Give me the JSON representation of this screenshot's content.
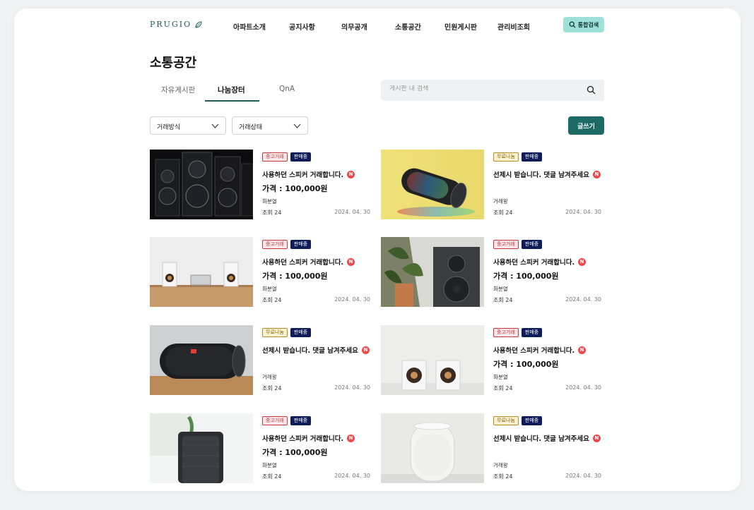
{
  "header": {
    "logo": "PRUGIO",
    "nav": [
      "아파트소개",
      "공지사항",
      "의무공개",
      "소통공간",
      "민원게시판",
      "관리비조회"
    ],
    "search_button": "통합검색"
  },
  "page_title": "소통공간",
  "tabs": [
    "자유게시판",
    "나눔장터",
    "QnA"
  ],
  "active_tab": "나눔장터",
  "board_search": {
    "placeholder": "게시판 내 검색"
  },
  "filters": {
    "method": "거래방식",
    "status": "거래상태"
  },
  "write_button": "글쓰기",
  "colors": {
    "accent": "#1e6a66",
    "used_badge": "#c5393d",
    "free_badge": "#b88c25",
    "sale_badge": "#0f1c5a",
    "new_dot": "#f0474b"
  },
  "posts": [
    {
      "image": "speaker-wall-photo",
      "type": "중고거래",
      "state": "판매중",
      "title": "사용하던 스피커 거래합니다.",
      "new": "N",
      "price": "가격 : 100,000원",
      "author": "화분열",
      "views": "조회 24",
      "date": "2024. 04. 30"
    },
    {
      "image": "cylinder-speaker-yellow-photo",
      "type": "무료나눔",
      "state": "판매중",
      "title": "선제시 받습니다. 댓글 남겨주세요",
      "new": "N",
      "price": "",
      "author": "거래왕",
      "views": "조회 24",
      "date": "2024. 04. 30"
    },
    {
      "image": "bookshelf-speakers-photo",
      "type": "중고거래",
      "state": "판매중",
      "title": "사용하던 스피커 거래합니다.",
      "new": "N",
      "price": "가격 : 100,000원",
      "author": "화분열",
      "views": "조회 24",
      "date": "2024. 04. 30"
    },
    {
      "image": "speaker-plant-photo",
      "type": "중고거래",
      "state": "판매중",
      "title": "사용하던 스피커 거래합니다.",
      "new": "N",
      "price": "가격 : 100,000원",
      "author": "화분열",
      "views": "조회 24",
      "date": "2024. 04. 30"
    },
    {
      "image": "portable-speaker-photo",
      "type": "무료나눔",
      "state": "판매중",
      "title": "선제시 받습니다. 댓글 남겨주세요",
      "new": "N",
      "price": "",
      "author": "거래왕",
      "views": "조회 24",
      "date": "2024. 04. 30"
    },
    {
      "image": "white-speakers-photo",
      "type": "중고거래",
      "state": "판매중",
      "title": "사용하던 스피커 거래합니다.",
      "new": "N",
      "price": "가격 : 100,000원",
      "author": "화분열",
      "views": "조회 24",
      "date": "2024. 04. 30"
    },
    {
      "image": "square-speaker-photo",
      "type": "중고거래",
      "state": "판매중",
      "title": "사용하던 스피커 거래합니다.",
      "new": "N",
      "price": "가격 : 100,000원",
      "author": "화분열",
      "views": "조회 24",
      "date": "2024. 04. 30"
    },
    {
      "image": "smart-speaker-photo",
      "type": "무료나눔",
      "state": "판매중",
      "title": "선제시 받습니다. 댓글 남겨주세요",
      "new": "N",
      "price": "",
      "author": "거래왕",
      "views": "조회 24",
      "date": "2024. 04. 30"
    }
  ]
}
